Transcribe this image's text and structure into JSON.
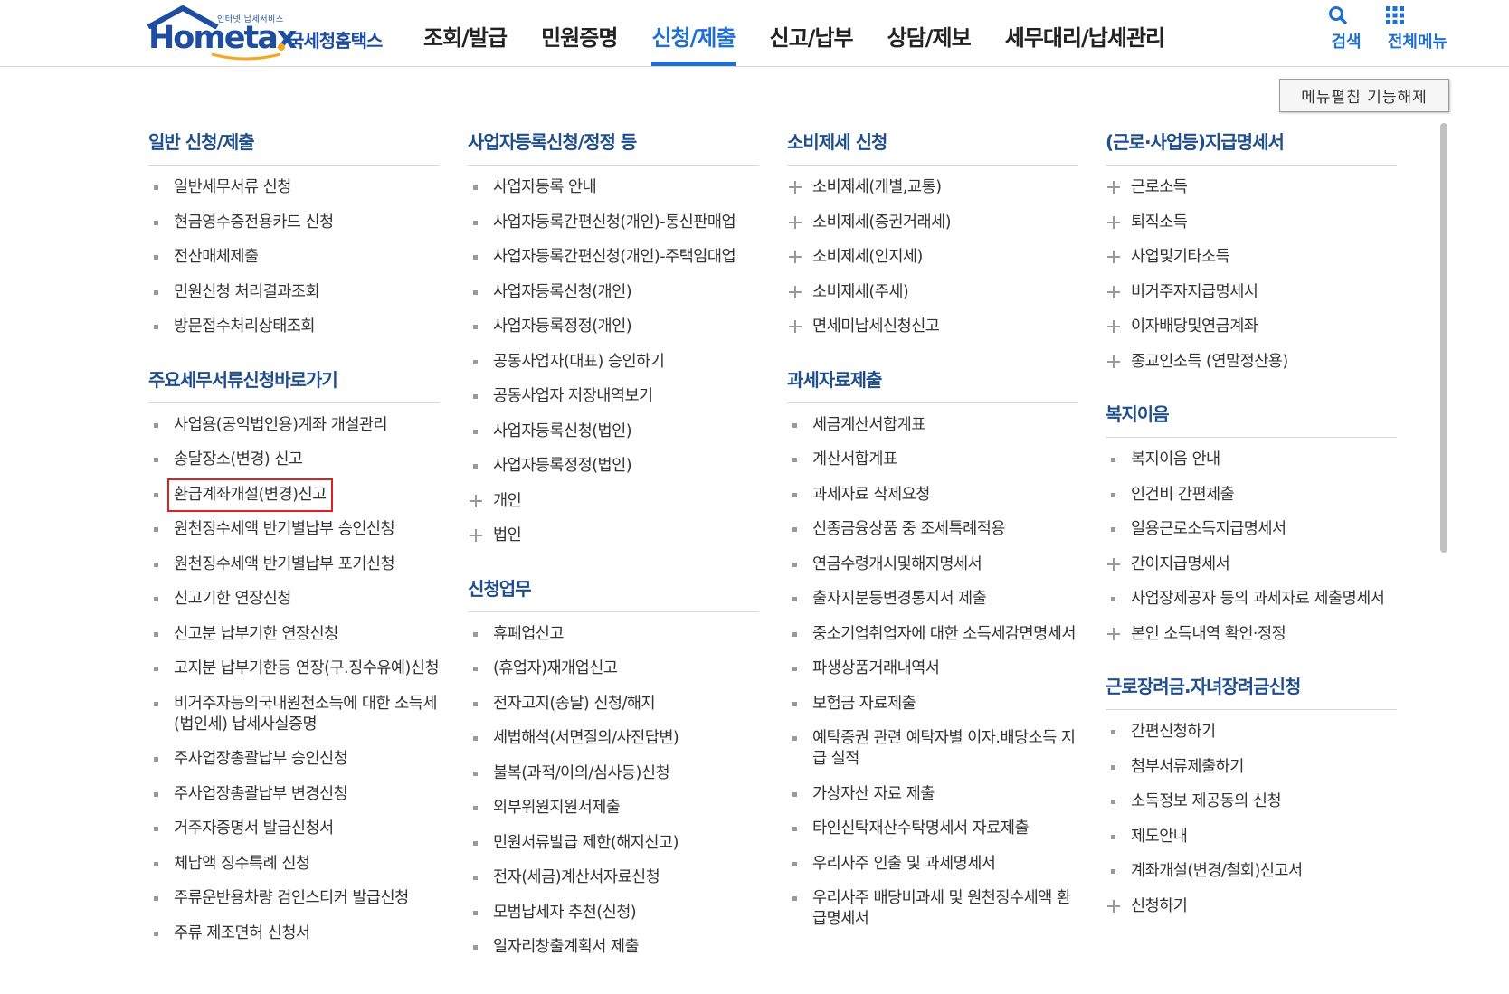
{
  "logo": {
    "small_text": "인터넷 납세서비스",
    "main_text": "Hometax",
    "korean_text": "국세청홈택스"
  },
  "gnb": [
    {
      "label": "조회/발급",
      "active": false
    },
    {
      "label": "민원증명",
      "active": false
    },
    {
      "label": "신청/제출",
      "active": true
    },
    {
      "label": "신고/납부",
      "active": false
    },
    {
      "label": "상담/제보",
      "active": false
    },
    {
      "label": "세무대리/납세관리",
      "active": false
    }
  ],
  "util": {
    "search_label": "검색",
    "search_icon": "magnifier-icon",
    "all_menu_label": "전체메뉴",
    "all_menu_icon": "grid-icon"
  },
  "toggle_button": "메뉴펼침 기능해제",
  "colors": {
    "brand": "#1f4ea1",
    "active": "#1f6fd1",
    "section_title": "#1f4e8c",
    "highlight_box": "#e02020"
  },
  "columns": [
    {
      "sections": [
        {
          "title": "일반 신청/제출",
          "items": [
            {
              "label": "일반세무서류 신청",
              "type": "bullet"
            },
            {
              "label": "현금영수증전용카드 신청",
              "type": "bullet"
            },
            {
              "label": "전산매체제출",
              "type": "bullet"
            },
            {
              "label": "민원신청 처리결과조회",
              "type": "bullet"
            },
            {
              "label": "방문접수처리상태조회",
              "type": "bullet"
            }
          ]
        },
        {
          "title": "주요세무서류신청바로가기",
          "items": [
            {
              "label": "사업용(공익법인용)계좌 개설관리",
              "type": "bullet"
            },
            {
              "label": "송달장소(변경) 신고",
              "type": "bullet"
            },
            {
              "label": "환급계좌개설(변경)신고",
              "type": "bullet",
              "highlight": true
            },
            {
              "label": "원천징수세액 반기별납부 승인신청",
              "type": "bullet"
            },
            {
              "label": "원천징수세액 반기별납부 포기신청",
              "type": "bullet"
            },
            {
              "label": "신고기한 연장신청",
              "type": "bullet"
            },
            {
              "label": "신고분 납부기한 연장신청",
              "type": "bullet"
            },
            {
              "label": "고지분 납부기한등 연장(구.징수유예)신청",
              "type": "bullet"
            },
            {
              "label": "비거주자등의국내원천소득에 대한 소득세(법인세) 납세사실증명",
              "type": "bullet"
            },
            {
              "label": "주사업장총괄납부 승인신청",
              "type": "bullet"
            },
            {
              "label": "주사업장총괄납부 변경신청",
              "type": "bullet"
            },
            {
              "label": "거주자증명서 발급신청서",
              "type": "bullet"
            },
            {
              "label": "체납액 징수특례 신청",
              "type": "bullet"
            },
            {
              "label": "주류운반용차량 검인스티커 발급신청",
              "type": "bullet"
            },
            {
              "label": "주류 제조면허 신청서",
              "type": "bullet"
            }
          ]
        }
      ]
    },
    {
      "sections": [
        {
          "title": "사업자등록신청/정정 등",
          "items": [
            {
              "label": "사업자등록 안내",
              "type": "bullet"
            },
            {
              "label": "사업자등록간편신청(개인)-통신판매업",
              "type": "bullet"
            },
            {
              "label": "사업자등록간편신청(개인)-주택임대업",
              "type": "bullet"
            },
            {
              "label": "사업자등록신청(개인)",
              "type": "bullet"
            },
            {
              "label": "사업자등록정정(개인)",
              "type": "bullet"
            },
            {
              "label": "공동사업자(대표) 승인하기",
              "type": "bullet"
            },
            {
              "label": "공동사업자 저장내역보기",
              "type": "bullet"
            },
            {
              "label": "사업자등록신청(법인)",
              "type": "bullet"
            },
            {
              "label": "사업자등록정정(법인)",
              "type": "bullet"
            },
            {
              "label": "개인",
              "type": "plus"
            },
            {
              "label": "법인",
              "type": "plus"
            }
          ]
        },
        {
          "title": "신청업무",
          "items": [
            {
              "label": "휴폐업신고",
              "type": "bullet"
            },
            {
              "label": "(휴업자)재개업신고",
              "type": "bullet"
            },
            {
              "label": "전자고지(송달) 신청/해지",
              "type": "bullet"
            },
            {
              "label": "세법해석(서면질의/사전답변)",
              "type": "bullet"
            },
            {
              "label": "불복(과적/이의/심사등)신청",
              "type": "bullet"
            },
            {
              "label": "외부위원지원서제출",
              "type": "bullet"
            },
            {
              "label": "민원서류발급 제한(해지신고)",
              "type": "bullet"
            },
            {
              "label": "전자(세금)계산서자료신청",
              "type": "bullet"
            },
            {
              "label": "모범납세자 추천(신청)",
              "type": "bullet"
            },
            {
              "label": "일자리창출계획서 제출",
              "type": "bullet"
            }
          ]
        }
      ]
    },
    {
      "sections": [
        {
          "title": "소비제세 신청",
          "items": [
            {
              "label": "소비제세(개별,교통)",
              "type": "plus"
            },
            {
              "label": "소비제세(증권거래세)",
              "type": "plus"
            },
            {
              "label": "소비제세(인지세)",
              "type": "plus"
            },
            {
              "label": "소비제세(주세)",
              "type": "plus"
            },
            {
              "label": "면세미납세신청신고",
              "type": "plus"
            }
          ]
        },
        {
          "title": "과세자료제출",
          "items": [
            {
              "label": "세금계산서합계표",
              "type": "bullet"
            },
            {
              "label": "계산서합계표",
              "type": "bullet"
            },
            {
              "label": "과세자료 삭제요청",
              "type": "bullet"
            },
            {
              "label": "신종금융상품 중 조세특례적용",
              "type": "bullet"
            },
            {
              "label": "연금수령개시및해지명세서",
              "type": "bullet"
            },
            {
              "label": "출자지분등변경통지서 제출",
              "type": "bullet"
            },
            {
              "label": "중소기업취업자에 대한 소득세감면명세서",
              "type": "bullet"
            },
            {
              "label": "파생상품거래내역서",
              "type": "bullet"
            },
            {
              "label": "보험금 자료제출",
              "type": "bullet"
            },
            {
              "label": "예탁증권 관련 예탁자별 이자.배당소득 지급 실적",
              "type": "bullet"
            },
            {
              "label": "가상자산 자료 제출",
              "type": "bullet"
            },
            {
              "label": "타인신탁재산수탁명세서 자료제출",
              "type": "bullet"
            },
            {
              "label": "우리사주 인출 및 과세명세서",
              "type": "bullet"
            },
            {
              "label": "우리사주 배당비과세 및 원천징수세액 환급명세서",
              "type": "bullet"
            }
          ]
        }
      ]
    },
    {
      "sections": [
        {
          "title": "(근로·사업등)지급명세서",
          "items": [
            {
              "label": "근로소득",
              "type": "plus"
            },
            {
              "label": "퇴직소득",
              "type": "plus"
            },
            {
              "label": "사업및기타소득",
              "type": "plus"
            },
            {
              "label": "비거주자지급명세서",
              "type": "plus"
            },
            {
              "label": "이자배당및연금계좌",
              "type": "plus"
            },
            {
              "label": "종교인소득 (연말정산용)",
              "type": "plus"
            }
          ]
        },
        {
          "title": "복지이음",
          "items": [
            {
              "label": "복지이음 안내",
              "type": "bullet"
            },
            {
              "label": "인건비 간편제출",
              "type": "bullet"
            },
            {
              "label": "일용근로소득지급명세서",
              "type": "bullet"
            },
            {
              "label": "간이지급명세서",
              "type": "plus"
            },
            {
              "label": "사업장제공자 등의 과세자료 제출명세서",
              "type": "bullet"
            },
            {
              "label": "본인 소득내역 확인·정정",
              "type": "plus"
            }
          ]
        },
        {
          "title": "근로장려금.자녀장려금신청",
          "items": [
            {
              "label": "간편신청하기",
              "type": "bullet"
            },
            {
              "label": "첨부서류제출하기",
              "type": "bullet"
            },
            {
              "label": "소득정보 제공동의 신청",
              "type": "bullet"
            },
            {
              "label": "제도안내",
              "type": "bullet"
            },
            {
              "label": "계좌개설(변경/철회)신고서",
              "type": "bullet"
            },
            {
              "label": "신청하기",
              "type": "plus"
            }
          ]
        }
      ]
    }
  ]
}
